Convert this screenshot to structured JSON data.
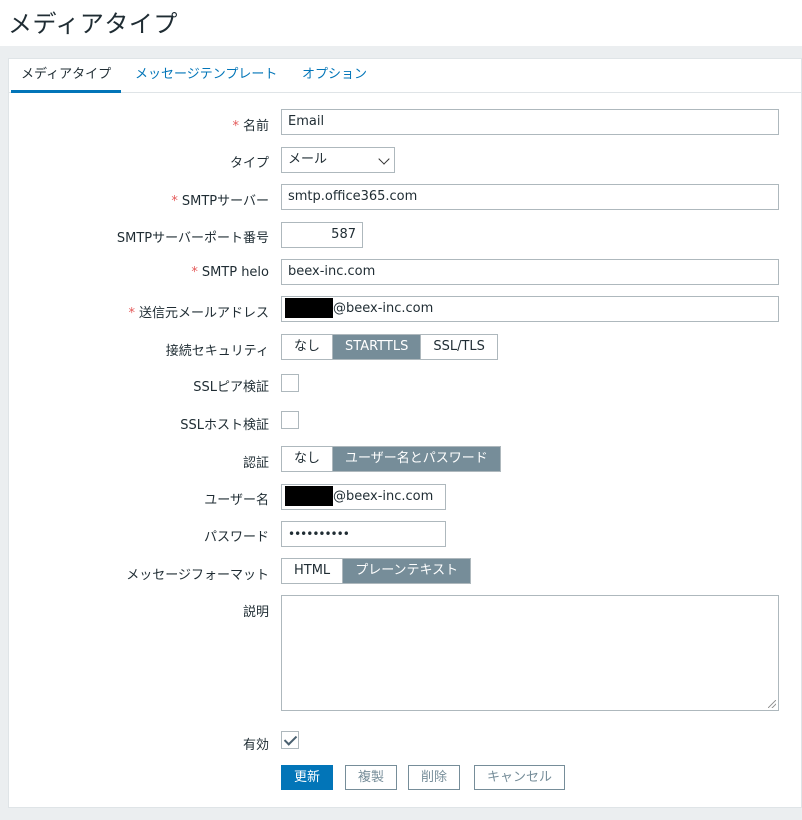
{
  "page": {
    "title": "メディアタイプ"
  },
  "tabs": [
    {
      "label": "メディアタイプ"
    },
    {
      "label": "メッセージテンプレート"
    },
    {
      "label": "オプション"
    }
  ],
  "form": {
    "name": {
      "label": "名前",
      "value": "Email"
    },
    "type": {
      "label": "タイプ",
      "value": "メール"
    },
    "smtp_server": {
      "label": "SMTPサーバー",
      "value": "smtp.office365.com"
    },
    "smtp_port": {
      "label": "SMTPサーバーポート番号",
      "value": "587"
    },
    "smtp_helo": {
      "label": "SMTP helo",
      "value": "beex-inc.com"
    },
    "smtp_email": {
      "label": "送信元メールアドレス",
      "value_suffix": "@beex-inc.com"
    },
    "security": {
      "label": "接続セキュリティ",
      "options": [
        "なし",
        "STARTTLS",
        "SSL/TLS"
      ],
      "selected": "STARTTLS"
    },
    "ssl_peer": {
      "label": "SSLピア検証",
      "checked": false
    },
    "ssl_host": {
      "label": "SSLホスト検証",
      "checked": false
    },
    "auth": {
      "label": "認証",
      "options": [
        "なし",
        "ユーザー名とパスワード"
      ],
      "selected": "ユーザー名とパスワード"
    },
    "username": {
      "label": "ユーザー名",
      "value_suffix": "@beex-inc.com"
    },
    "password": {
      "label": "パスワード",
      "value": "••••••••••"
    },
    "format": {
      "label": "メッセージフォーマット",
      "options": [
        "HTML",
        "プレーンテキスト"
      ],
      "selected": "プレーンテキスト"
    },
    "description": {
      "label": "説明",
      "value": ""
    },
    "enabled": {
      "label": "有効",
      "checked": true
    }
  },
  "buttons": {
    "update": "更新",
    "clone": "複製",
    "delete": "削除",
    "cancel": "キャンセル"
  },
  "colors": {
    "accent": "#0275b8",
    "selected_segment": "#768d99",
    "required": "#e45959"
  }
}
